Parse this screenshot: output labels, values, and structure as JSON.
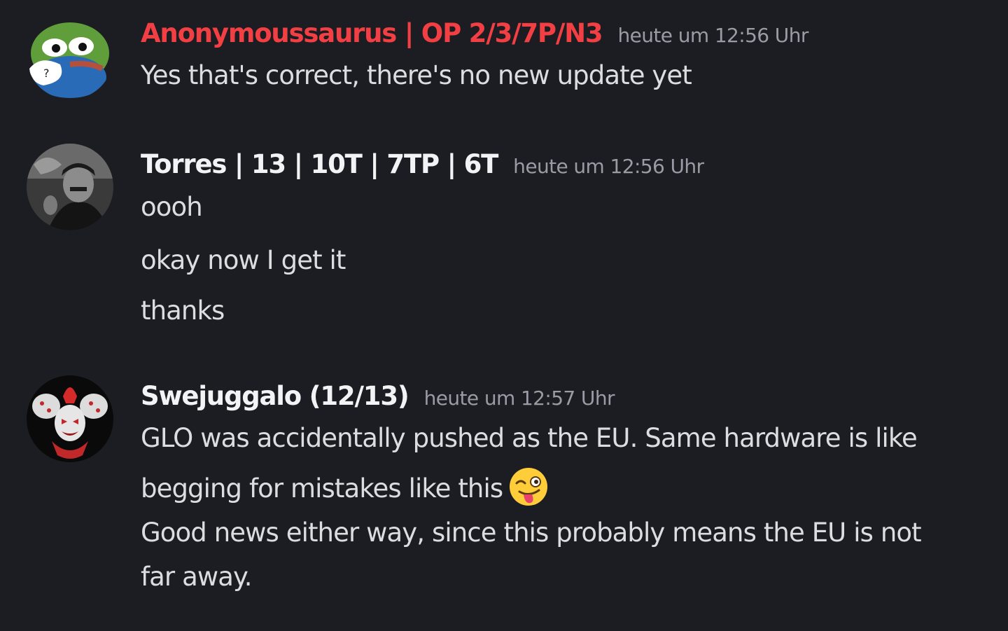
{
  "colors": {
    "background": "#1c1d22",
    "username_op": "#f23f43",
    "username_default": "#f2f3f5",
    "message_text": "#dbdee1",
    "timestamp": "#9a9ca5"
  },
  "messages": [
    {
      "username": "Anonymoussaurus | OP 2/3/7P/N3",
      "timestamp": "heute um 12:56 Uhr",
      "avatar": "pepe-frog-avatar",
      "lines": [
        "Yes that's correct, there's no new update yet"
      ]
    },
    {
      "username": "Torres | 13 | 10T | 7TP | 6T",
      "timestamp": "heute um 12:56 Uhr",
      "avatar": "bw-man-portrait-avatar",
      "lines": [
        "oooh",
        "okay now I get it",
        "thanks"
      ]
    },
    {
      "username": "Swejuggalo (12/13)",
      "timestamp": "heute um 12:57 Uhr",
      "avatar": "clown-avatar",
      "lines": [
        "GLO was accidentally pushed as the EU. Same hardware is like",
        "begging for mistakes like this",
        "Good news either way, since this probably means the EU is not",
        "far away."
      ],
      "emoji": "winking-face-with-tongue-emoji"
    }
  ]
}
